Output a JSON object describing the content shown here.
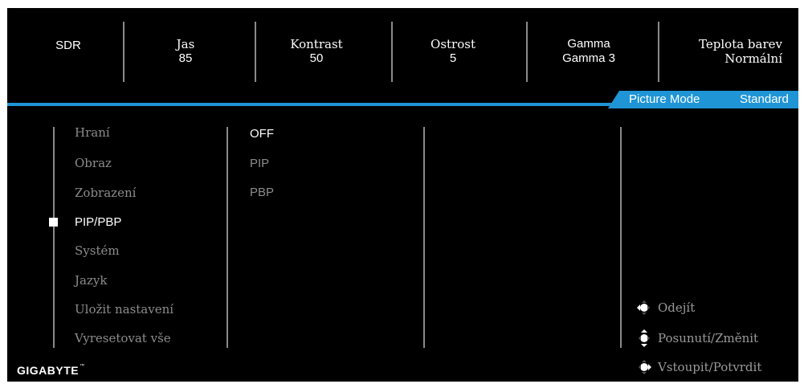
{
  "status_bar": {
    "mode": "SDR",
    "brightness": {
      "label": "Jas",
      "value": "85"
    },
    "contrast": {
      "label": "Kontrast",
      "value": "50"
    },
    "sharpness": {
      "label": "Ostrost",
      "value": "5"
    },
    "gamma": {
      "label": "Gamma",
      "value": "Gamma 3"
    },
    "color_temp": {
      "label": "Teplota barev",
      "value": "Normální"
    }
  },
  "picture_mode": {
    "label": "Picture Mode",
    "value": "Standard"
  },
  "menu": {
    "items": [
      {
        "label": "Hraní"
      },
      {
        "label": "Obraz"
      },
      {
        "label": "Zobrazení"
      },
      {
        "label": "PIP/PBP"
      },
      {
        "label": "Systém"
      },
      {
        "label": "Jazyk"
      },
      {
        "label": "Uložit nastavení"
      },
      {
        "label": "Vyresetovat vše"
      }
    ],
    "selected_index": 3
  },
  "submenu": {
    "items": [
      {
        "label": "OFF"
      },
      {
        "label": "PIP"
      },
      {
        "label": "PBP"
      }
    ],
    "selected_index": 0
  },
  "help": {
    "exit": "Odejít",
    "move": "Posunutí/Změnit",
    "enter": "Vstoupit/Potvrdit"
  },
  "brand": "GIGABYTE",
  "colors": {
    "accent": "#1f95d6",
    "background": "#000000",
    "inactive_text": "#8c8c8c"
  }
}
